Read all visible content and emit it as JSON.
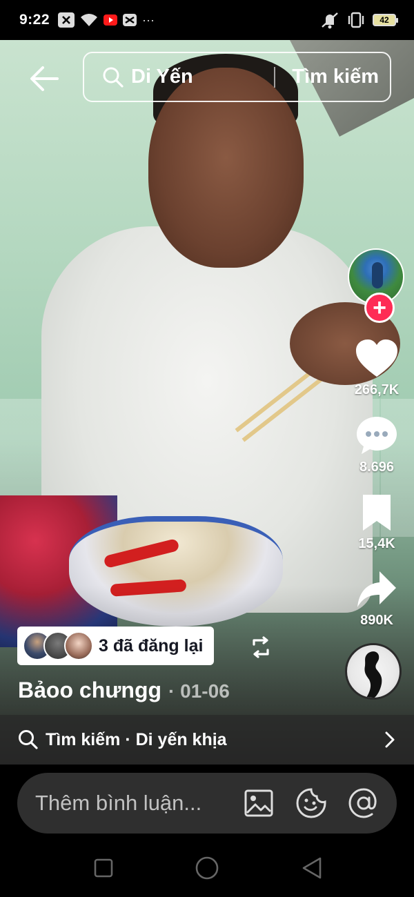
{
  "status_bar": {
    "time": "9:22",
    "left_icons": [
      "x-close-icon",
      "wifi-icon",
      "youtube-icon",
      "capcut-icon",
      "more-dots-icon"
    ],
    "more_dots": "···",
    "right_icons": [
      "mute-vibrate-icon",
      "vibrate-icon"
    ],
    "battery": "42"
  },
  "header": {
    "back_icon": "back-arrow-icon",
    "search_query": "Di Yến",
    "search_action": "Tìm kiếm"
  },
  "rail": {
    "like_count": "266,7K",
    "comment_count": "8.696",
    "bookmark_count": "15,4K",
    "share_count": "890K",
    "follow_symbol": "+"
  },
  "repost": {
    "text": "3 đã đăng lại"
  },
  "caption": {
    "author": "Bảoo chưngg",
    "date": "· 01-06"
  },
  "related_search": {
    "text": "Tìm kiếm · Di yến khịa"
  },
  "comment_bar": {
    "placeholder": "Thêm bình luận..."
  },
  "colors": {
    "accent": "#fe2c55",
    "background": "#000000",
    "comment_box": "#2f2f2f"
  }
}
